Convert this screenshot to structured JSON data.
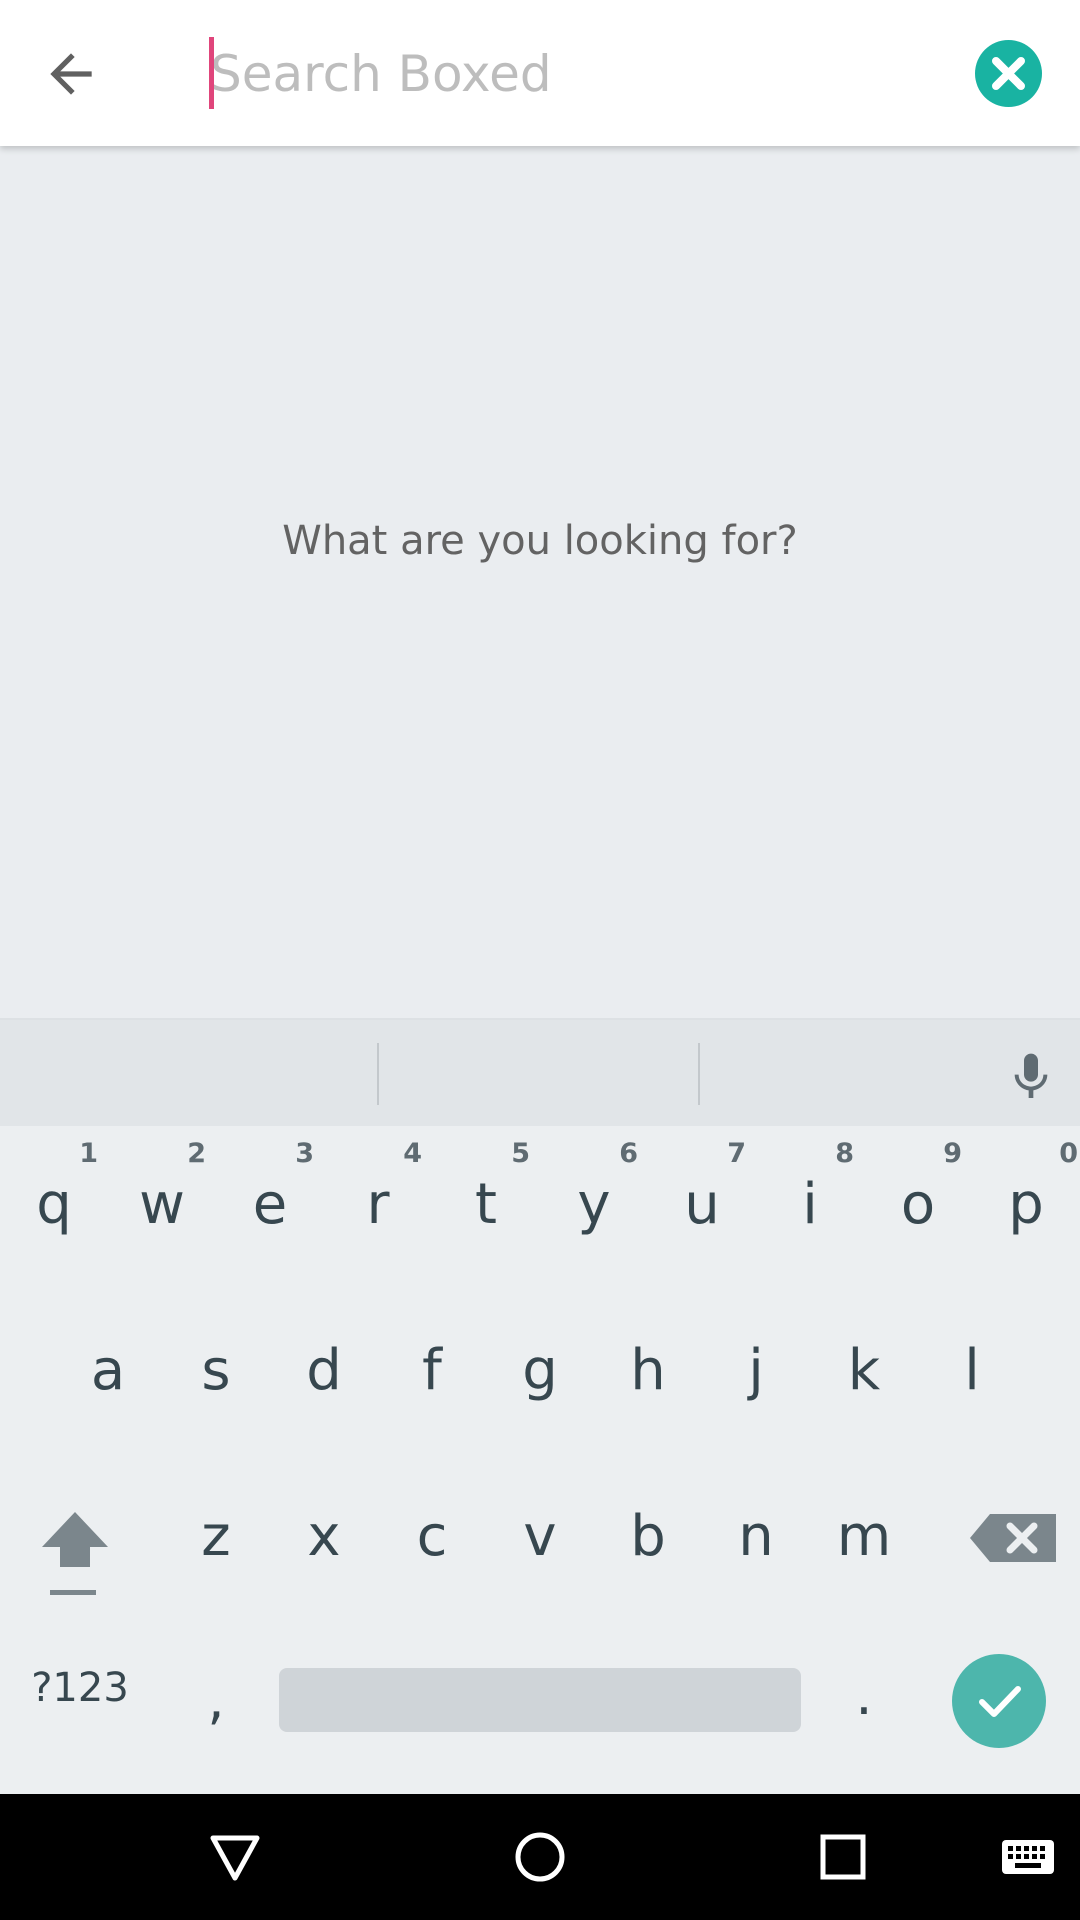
{
  "search": {
    "placeholder": "Search Boxed",
    "value": ""
  },
  "empty_state": {
    "prompt": "What are you looking for?"
  },
  "keyboard": {
    "row1": [
      {
        "key": "q",
        "hint": "1"
      },
      {
        "key": "w",
        "hint": "2"
      },
      {
        "key": "e",
        "hint": "3"
      },
      {
        "key": "r",
        "hint": "4"
      },
      {
        "key": "t",
        "hint": "5"
      },
      {
        "key": "y",
        "hint": "6"
      },
      {
        "key": "u",
        "hint": "7"
      },
      {
        "key": "i",
        "hint": "8"
      },
      {
        "key": "o",
        "hint": "9"
      },
      {
        "key": "p",
        "hint": "0"
      }
    ],
    "row2": [
      "a",
      "s",
      "d",
      "f",
      "g",
      "h",
      "j",
      "k",
      "l"
    ],
    "row3": [
      "z",
      "x",
      "c",
      "v",
      "b",
      "n",
      "m"
    ],
    "symbols_label": "?123",
    "comma": ",",
    "period": "."
  },
  "colors": {
    "accent": "#19b3a2",
    "cursor": "#e0457b",
    "enter": "#4db6ac"
  },
  "icons": {
    "back": "arrow-left-icon",
    "clear": "close-circle-icon",
    "mic": "microphone-icon",
    "shift": "shift-icon",
    "backspace": "backspace-icon",
    "enter": "checkmark-icon",
    "nav_back": "triangle-back-icon",
    "nav_home": "circle-home-icon",
    "nav_recents": "square-recents-icon",
    "nav_keyboard": "keyboard-icon"
  }
}
